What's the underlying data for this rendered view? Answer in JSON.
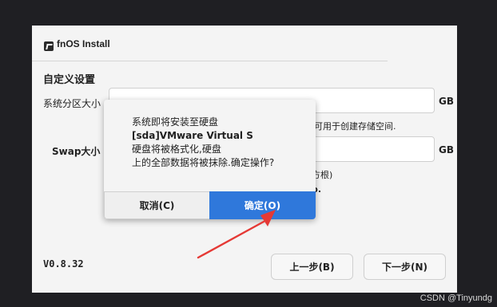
{
  "window": {
    "title": "fnOS Install",
    "section_title": "自定义设置",
    "system_partition_label": "系统分区大小",
    "swap_label": "Swap大小",
    "unit_gb": "GB",
    "hint_remaining_space": "空间可用于创建存储空间.",
    "hint_partial_1": "方根)",
    "hint_partial_2": "p.",
    "version": "V0.8.32",
    "prev_button": "上一步(B)",
    "next_button": "下一步(N)"
  },
  "dialog": {
    "lines": [
      "系统即将安装至硬盘",
      "[sda]VMware Virtual S",
      "硬盘将被格式化,硬盘",
      "上的全部数据将被抹除.确定操作?"
    ],
    "cancel_button": "取消(C)",
    "confirm_button": "确定(O)"
  },
  "watermark": "CSDN @Tinyundg",
  "colors": {
    "background": "#1f1f23",
    "window": "#f4f4f4",
    "confirm_button": "#2f78db",
    "annotation_arrow": "#e53935"
  }
}
